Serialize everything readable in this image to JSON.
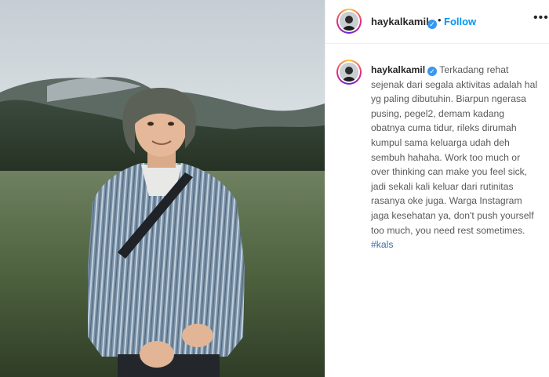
{
  "post": {
    "username": "haykalkamil",
    "follow_label": "Follow",
    "separator": "•",
    "more_label": "•••",
    "verified_glyph": "✓",
    "caption": "Terkadang rehat sejenak dari segala aktivitas adalah hal yg paling dibutuhin. Biarpun ngerasa pusing, pegel2, demam kadang obatnya cuma tidur, rileks dirumah kumpul sama keluarga udah deh sembuh hahaha. Work too much or over thinking can make you feel sick, jadi sekali kali keluar dari rutinitas rasanya oke juga. Warga Instagram jaga kesehatan ya, don't push yourself too much, you need rest sometimes.",
    "hashtag": "#kals"
  },
  "icons": {
    "verified": "verified-badge-icon",
    "more": "more-options-icon"
  },
  "colors": {
    "follow": "#0095f6",
    "verified": "#3897f0",
    "hashtag": "#3b6ea5"
  }
}
